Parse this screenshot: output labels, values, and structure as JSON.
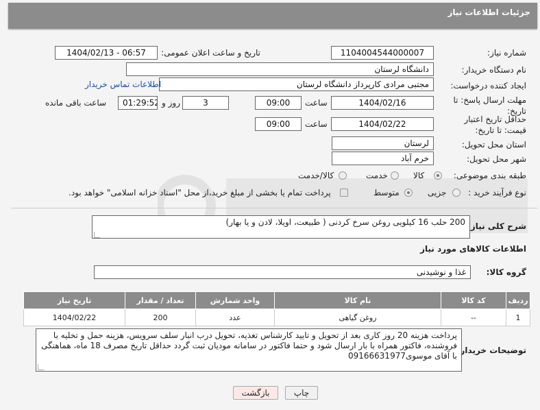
{
  "header": {
    "title": "جزئیات اطلاعات نیاز"
  },
  "form": {
    "need_number_label": "شماره نیاز:",
    "need_number": "1104004544000007",
    "announce_label": "تاریخ و ساعت اعلان عمومی:",
    "announce_value": "1404/02/13 - 06:57",
    "buyer_org_label": "نام دستگاه خریدار:",
    "buyer_org": "دانشگاه لرستان",
    "creator_label": "ایجاد کننده درخواست:",
    "creator": "مجتبی مرادی کارپرداز دانشگاه لرستان",
    "contact_link": "اطلاعات تماس خریدار",
    "reply_deadline_label": "مهلت ارسال پاسخ: تا تاریخ:",
    "reply_date": "1404/02/16",
    "time_label": "ساعت",
    "reply_time": "09:00",
    "days_value": "3",
    "days_label": "روز و",
    "remaining_time": "01:29:52",
    "remaining_label": "ساعت باقی مانده",
    "price_validity_label": "حداقل تاریخ اعتبار قیمت: تا تاریخ:",
    "price_date": "1404/02/22",
    "price_time": "09:00",
    "province_label": "استان محل تحویل:",
    "province": "لرستان",
    "city_label": "شهر محل تحویل:",
    "city": "خرم آباد",
    "category_label": "طبقه بندی موضوعی:",
    "category_options": [
      "کالا",
      "خدمت",
      "کالا/خدمت"
    ],
    "category_selected": "کالا",
    "process_label": "نوع فرآیند خرید :",
    "process_options": [
      "جزیی",
      "متوسط"
    ],
    "process_selected": "متوسط",
    "payment_note": "پرداخت تمام یا بخشی از مبلغ خرید،از محل \"اسناد خزانه اسلامی\" خواهد بود."
  },
  "description": {
    "label": "شرح کلی نیاز:",
    "text": "200 حلب 16 کیلویی روغن سرخ کردنی ( طبیعت، اویلا، لادن و یا بهار)"
  },
  "goods": {
    "section_title": "اطلاعات کالاهای مورد نیاز",
    "group_label": "گروه کالا:",
    "group_value": "غذا و نوشیدنی",
    "columns": [
      "ردیف",
      "کد کالا",
      "نام کالا",
      "واحد شمارش",
      "تعداد / مقدار",
      "تاریخ نیاز"
    ],
    "rows": [
      [
        "1",
        "--",
        "روغن گیاهی",
        "عدد",
        "200",
        "1404/02/22"
      ]
    ]
  },
  "buyer_notes": {
    "label": "توضیحات خریدار:",
    "text": "پرداخت هزینه 20 روز کاری بعد از تحویل و تایید کارشناس تغذیه، تحویل درب انبار سلف سرویس، هزینه حمل و تخلیه با فروشنده، فاکتور همراه با بار ارسال شود و حتما فاکتور در سامانه مودیان ثبت گردد حداقل تاریخ مصرف 18 ماه، هماهنگی با آقای موسوی09166631977"
  },
  "buttons": {
    "print": "چاپ",
    "back": "بازگشت"
  },
  "colors": {
    "header_bg": "#8c8c8c",
    "link": "#1a4fa3",
    "back_btn_bg": "#fde8e8",
    "page_bg": "#f4f4f4"
  }
}
